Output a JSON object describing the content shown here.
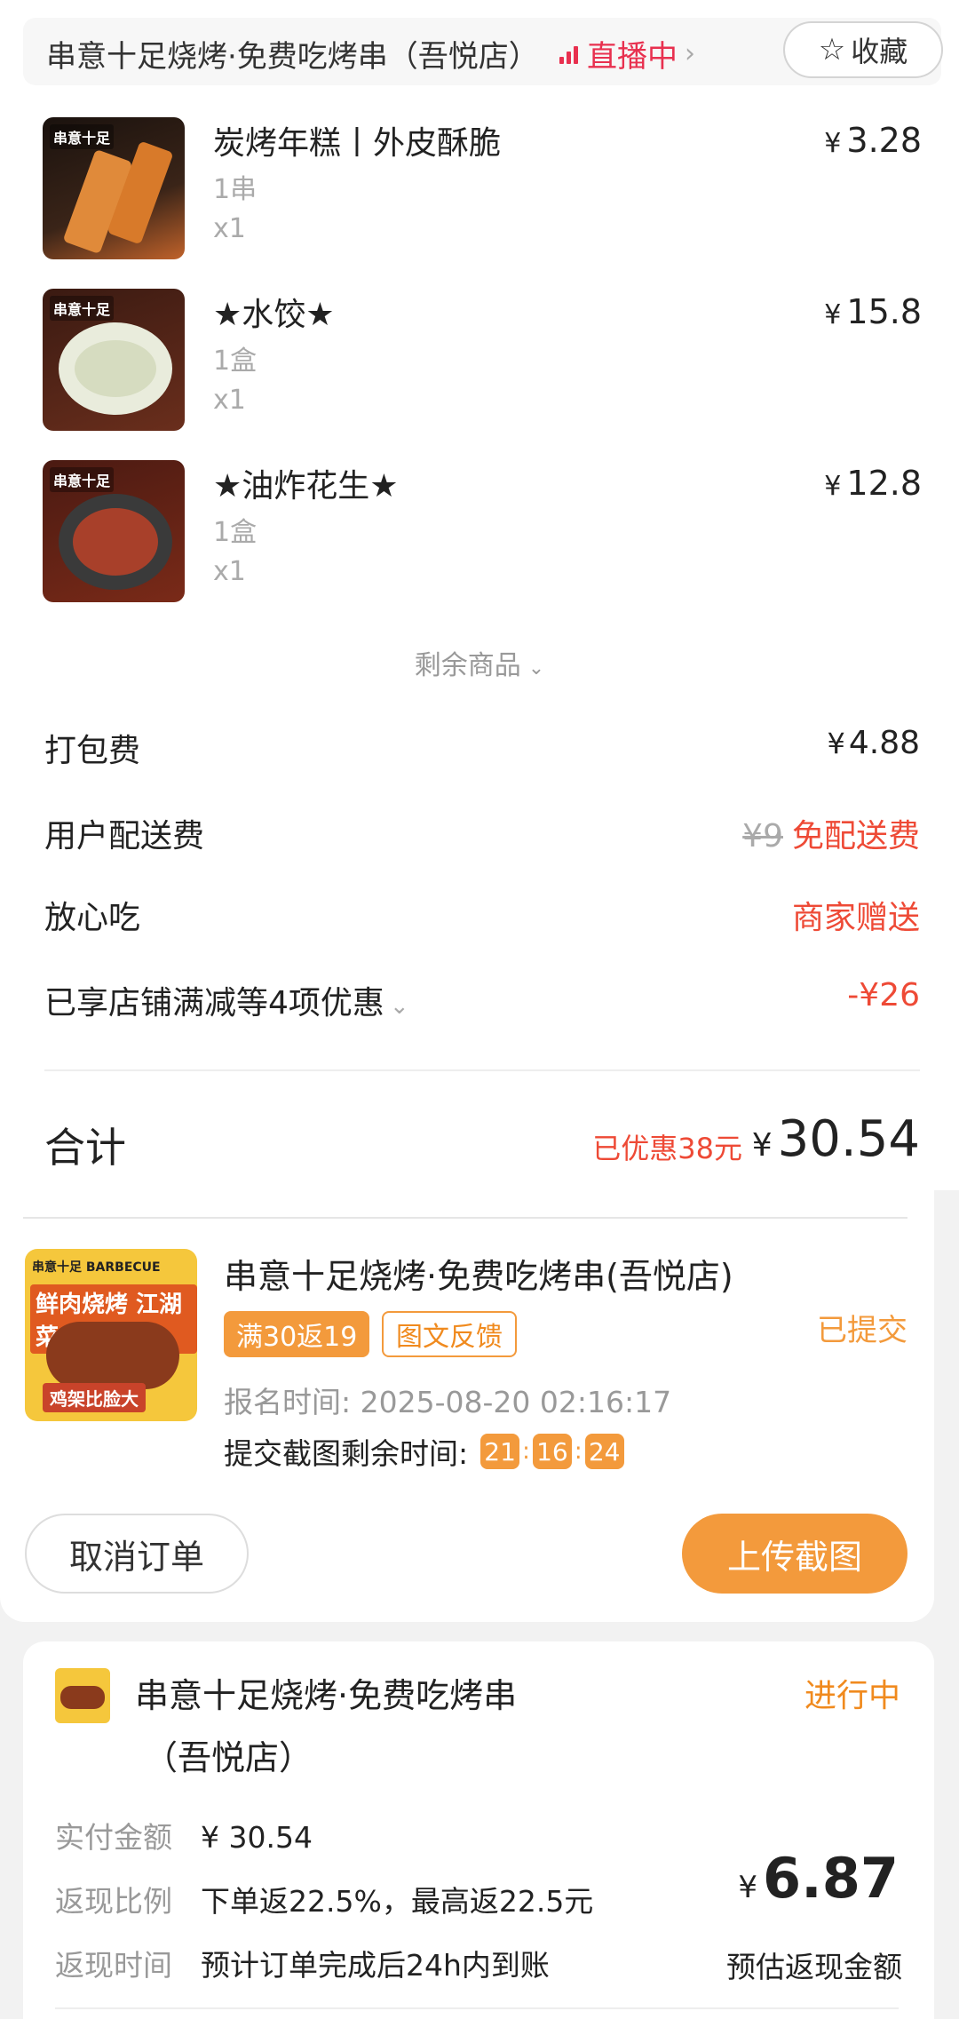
{
  "store_header": {
    "name": "串意十足烧烤·免费吃烤串（吾悦店）",
    "live_label": "直播中",
    "favorite_label": "收藏"
  },
  "items": [
    {
      "name": "炭烤年糕丨外皮酥脆",
      "spec": "1串",
      "qty": "x1",
      "currency": "¥",
      "price": "3.28",
      "thumb_brand": "串意十足"
    },
    {
      "name": "★水饺★",
      "spec": "1盒",
      "qty": "x1",
      "currency": "¥",
      "price": "15.8",
      "thumb_brand": "串意十足"
    },
    {
      "name": "★油炸花生★",
      "spec": "1盒",
      "qty": "x1",
      "currency": "¥",
      "price": "12.8",
      "thumb_brand": "串意十足"
    }
  ],
  "remaining_label": "剩余商品",
  "fees": {
    "packing": {
      "label": "打包费",
      "currency": "¥",
      "value": "4.88"
    },
    "delivery": {
      "label": "用户配送费",
      "original": "¥9",
      "value": "免配送费"
    },
    "assurance": {
      "label": "放心吃",
      "value": "商家赠送"
    },
    "discount": {
      "label": "已享店铺满减等4项优惠",
      "value": "-¥26"
    }
  },
  "total": {
    "label": "合计",
    "saved": "已优惠38元",
    "currency": "¥",
    "amount": "30.54"
  },
  "promo": {
    "title": "串意十足烧烤·免费吃烤串(吾悦店)",
    "tag_fill": "满30返19",
    "tag_line": "图文反馈",
    "status": "已提交",
    "signup_time": "报名时间: 2025-08-20 02:16:17",
    "countdown_label": "提交截图剩余时间:",
    "countdown": {
      "h": "21",
      "m": "16",
      "s": "24"
    },
    "cancel_label": "取消订单",
    "upload_label": "上传截图",
    "poster": {
      "line1": "串意十足 BARBECUE",
      "line2": "鲜肉烧烤 江湖菜",
      "line3": "鸡架比脸大"
    }
  },
  "cashback_card": {
    "title_line1": "串意十足烧烤·免费吃烤串",
    "title_line2": "（吾悦店）",
    "status": "进行中",
    "rows": [
      {
        "key": "实付金额",
        "value": "¥ 30.54"
      },
      {
        "key": "返现比例",
        "value": "下单返22.5%，最高返22.5元"
      },
      {
        "key": "返现时间",
        "value": "预计订单完成后24h内到账"
      }
    ],
    "cashback_currency": "¥",
    "cashback_amount": "6.87",
    "cashback_label": "预估返现金额"
  },
  "colors": {
    "accent_orange": "#f39a3c",
    "price_red": "#ee4a36",
    "live_red": "#e8304f"
  }
}
